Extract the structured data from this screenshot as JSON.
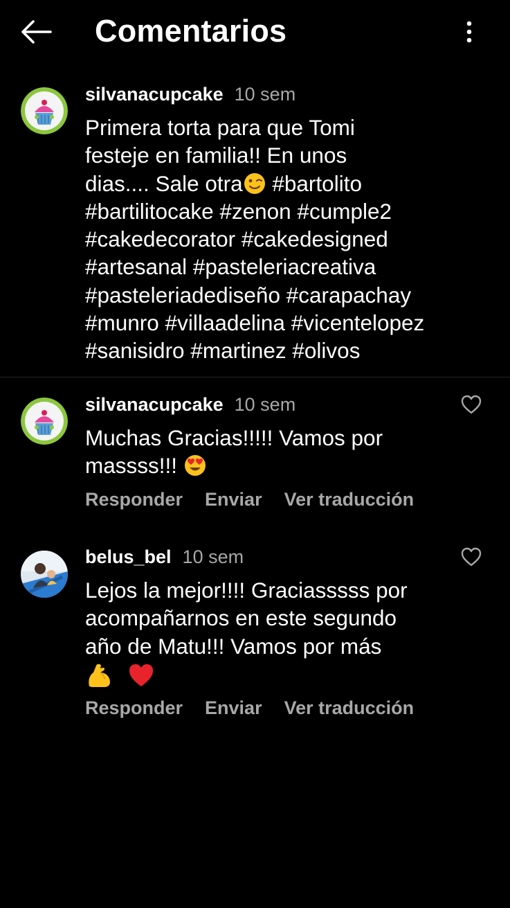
{
  "header": {
    "title": "Comentarios",
    "back_icon": "arrow-left-icon",
    "more_icon": "vertical-dots-icon"
  },
  "caption": {
    "username": "silvanacupcake",
    "time": "10 sem",
    "lines": [
      "Primera torta para que Tomi",
      "festeje en familia!! En unos",
      "dias.... Sale otra",
      "#bartilitocake #zenon #cumple2",
      "#cakedecorator #cakedesigned",
      "#artesanal #pasteleriacreativa",
      "#pasteleriadediseño #carapachay",
      "#munro #villaadelina #vicentelopez",
      "#sanisidro #martinez #olivos"
    ],
    "line3_after_emoji": " #bartolito",
    "emoji": "winking-face-emoji"
  },
  "comments": [
    {
      "username": "silvanacupcake",
      "time": "10 sem",
      "lines": [
        "Muchas Gracias!!!!! Vamos por",
        "massss!!! "
      ],
      "emoji": "heart-eyes-emoji",
      "actions": [
        "Responder",
        "Enviar",
        "Ver traducción"
      ]
    },
    {
      "username": "belus_bel",
      "time": "10 sem",
      "lines": [
        "Lejos la mejor!!!! Graciasssss por",
        "acompañarnos en este segundo",
        "año de Matu!!! Vamos por más"
      ],
      "emoji": [
        "flexed-biceps-emoji",
        "red-heart-emoji"
      ],
      "actions": [
        "Responder",
        "Enviar",
        "Ver traducción"
      ]
    }
  ],
  "colors": {
    "background": "#000000",
    "text": "#ffffff",
    "secondary_text": "#a8a8a8",
    "divider": "#262626"
  }
}
